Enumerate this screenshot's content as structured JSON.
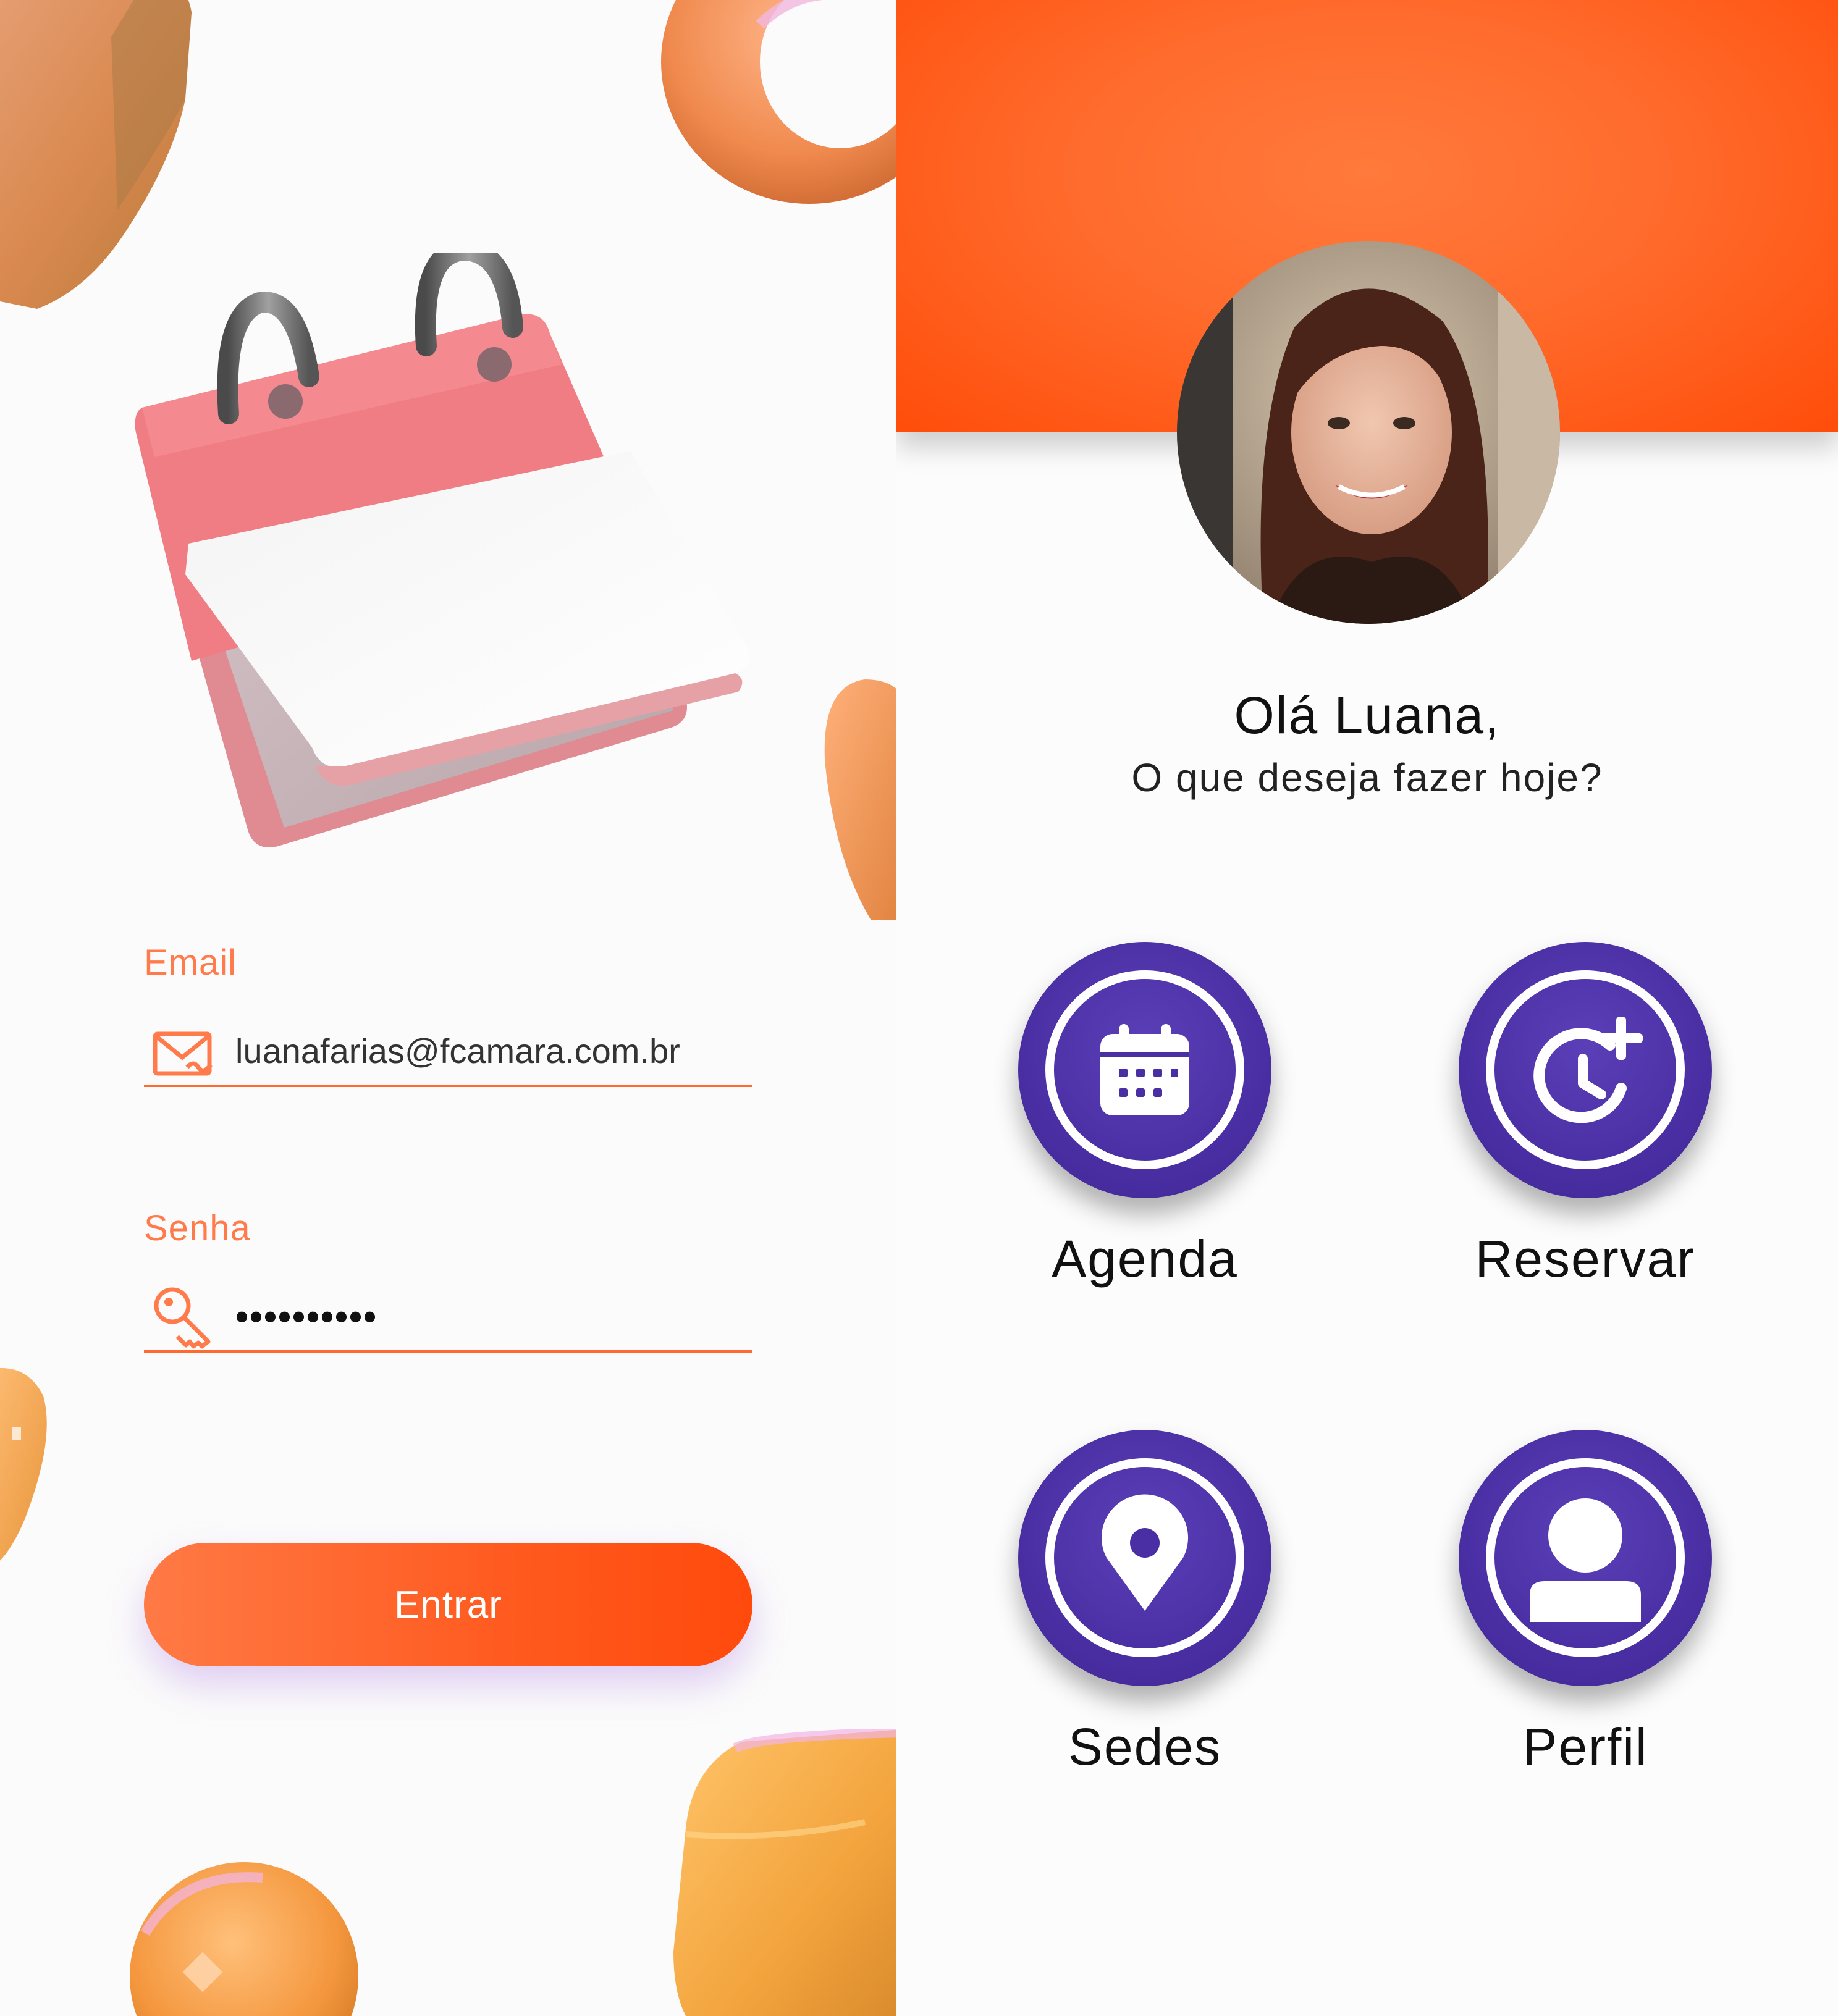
{
  "login": {
    "email_label": "Email",
    "email_value": "luanafarias@fcamara.com.br",
    "password_label": "Senha",
    "password_value": "••••••••••",
    "submit_label": "Entrar",
    "icons": {
      "email": "mail-icon",
      "password": "key-icon"
    },
    "colors": {
      "accent": "#ff6a30",
      "label": "#ff7b4c"
    }
  },
  "home": {
    "greeting": "Olá Luana,",
    "subtitle": "O que deseja fazer hoje?",
    "actions": [
      {
        "label": "Agenda",
        "icon": "calendar-icon"
      },
      {
        "label": "Reservar",
        "icon": "clock-plus-icon"
      },
      {
        "label": "Sedes",
        "icon": "location-pin-icon"
      },
      {
        "label": "Perfil",
        "icon": "user-icon"
      }
    ],
    "colors": {
      "header": "#ff5a1f",
      "button": "#4a2fa4"
    }
  }
}
